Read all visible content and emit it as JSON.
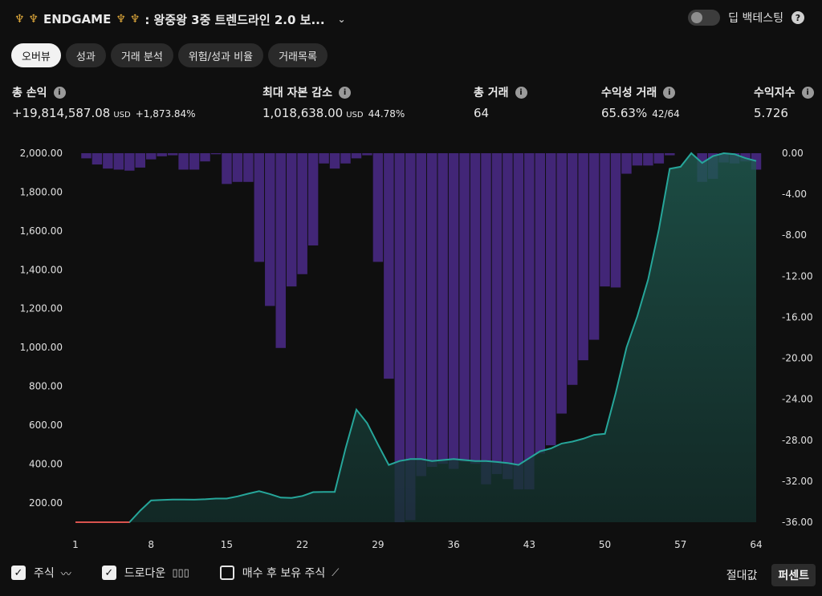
{
  "header": {
    "strategy_name": "ENDGAME",
    "strategy_suffix": ": 왕중왕 3중 트렌드라인 2.0 보...",
    "deep_backtest_label": "딥 백테스팅"
  },
  "tabs": [
    {
      "label": "오버뷰"
    },
    {
      "label": "성과"
    },
    {
      "label": "거래 분석"
    },
    {
      "label": "위험/성과 비율"
    },
    {
      "label": "거래목록"
    }
  ],
  "stats": {
    "net_profit": {
      "label": "총 손익",
      "value": "+19,814,587.08",
      "currency": "USD",
      "pct": "+1,873.84%"
    },
    "max_drawdown": {
      "label": "최대 자본 감소",
      "value": "1,018,638.00",
      "currency": "USD",
      "pct": "44.78%"
    },
    "total_trades": {
      "label": "총 거래",
      "value": "64"
    },
    "profitable": {
      "label": "수익성 거래",
      "value": "65.63%",
      "ratio": "42/64"
    },
    "profit_factor": {
      "label": "수익지수",
      "value": "5.726"
    }
  },
  "footer": {
    "equity_label": "주식",
    "drawdown_label": "드로다운",
    "buyhold_label": "매수 후 보유 주식",
    "absolute_label": "절대값",
    "percent_label": "퍼센트"
  },
  "colors": {
    "equity_line": "#26a69a",
    "equity_fill": "#1b4a43",
    "drawdown_bar": "#4b2a8a",
    "initial_segment": "#d9534f"
  },
  "icons": {
    "strategy": "trident-icon",
    "info": "info-icon",
    "help": "question-icon",
    "dropdown": "chevron-down-icon"
  },
  "chart_data": {
    "type": "bar+line",
    "x_ticks": [
      "1",
      "8",
      "15",
      "22",
      "29",
      "36",
      "43",
      "50",
      "57",
      "64"
    ],
    "x_range": [
      1,
      64
    ],
    "y_left": {
      "ticks": [
        "2,000.00",
        "1,800.00",
        "1,600.00",
        "1,400.00",
        "1,200.00",
        "1,000.00",
        "800.00",
        "600.00",
        "400.00",
        "200.00"
      ],
      "range": [
        100,
        2000
      ]
    },
    "y_right": {
      "ticks": [
        "0.00",
        "-4.00",
        "-8.00",
        "-12.00",
        "-16.00",
        "-20.00",
        "-24.00",
        "-28.00",
        "-32.00",
        "-36.00"
      ],
      "range": [
        -36,
        0
      ]
    },
    "series": [
      {
        "name": "주식",
        "axis": "left",
        "type": "area-line",
        "x": [
          1,
          2,
          3,
          4,
          5,
          6,
          7,
          8,
          9,
          10,
          11,
          12,
          13,
          14,
          15,
          16,
          17,
          18,
          19,
          20,
          21,
          22,
          23,
          24,
          25,
          26,
          27,
          28,
          29,
          30,
          31,
          32,
          33,
          34,
          35,
          36,
          37,
          38,
          39,
          40,
          41,
          42,
          43,
          44,
          45,
          46,
          47,
          48,
          49,
          50,
          51,
          52,
          53,
          54,
          55,
          56,
          57,
          58,
          59,
          60,
          61,
          62,
          63,
          64
        ],
        "values": [
          100,
          100,
          100,
          100,
          100,
          100,
          160,
          212,
          215,
          217,
          217,
          216,
          218,
          222,
          222,
          233,
          247,
          260,
          245,
          227,
          225,
          235,
          255,
          256,
          256,
          480,
          680,
          610,
          500,
          395,
          415,
          425,
          425,
          415,
          420,
          425,
          420,
          415,
          415,
          410,
          405,
          395,
          430,
          465,
          480,
          505,
          515,
          530,
          550,
          555,
          765,
          1000,
          1160,
          1350,
          1610,
          1920,
          1930,
          2000,
          1950,
          1985,
          2000,
          1995,
          1975,
          1960
        ]
      },
      {
        "name": "드로다운",
        "axis": "right",
        "type": "bar",
        "x": [
          1,
          2,
          3,
          4,
          5,
          6,
          7,
          8,
          9,
          10,
          11,
          12,
          13,
          14,
          15,
          16,
          17,
          18,
          19,
          20,
          21,
          22,
          23,
          24,
          25,
          26,
          27,
          28,
          29,
          30,
          31,
          32,
          33,
          34,
          35,
          36,
          37,
          38,
          39,
          40,
          41,
          42,
          43,
          44,
          45,
          46,
          47,
          48,
          49,
          50,
          51,
          52,
          53,
          54,
          55,
          56,
          57,
          58,
          59,
          60,
          61,
          62,
          63,
          64
        ],
        "values": [
          0,
          -0.5,
          -1.1,
          -1.5,
          -1.6,
          -1.7,
          -1.4,
          -0.6,
          -0.3,
          -0.2,
          -1.6,
          -1.6,
          -0.8,
          -0.1,
          -3.0,
          -2.8,
          -2.8,
          -10.6,
          -14.9,
          -19.0,
          -13.0,
          -11.8,
          -9.0,
          -1.0,
          -1.5,
          -1.0,
          -0.5,
          -0.2,
          -10.6,
          -22.0,
          -36.0,
          -35.8,
          -31.5,
          -30.6,
          -30.3,
          -30.8,
          -30.1,
          -30.3,
          -32.3,
          -31.3,
          -31.8,
          -32.8,
          -32.8,
          -29.3,
          -28.5,
          -25.4,
          -22.6,
          -20.2,
          -18.2,
          -13.0,
          -13.1,
          -2.0,
          -1.2,
          -1.2,
          -1.0,
          -0.2,
          0,
          0,
          -2.8,
          -2.5,
          -0.9,
          -1.0,
          -0.8,
          -1.6
        ]
      }
    ]
  }
}
